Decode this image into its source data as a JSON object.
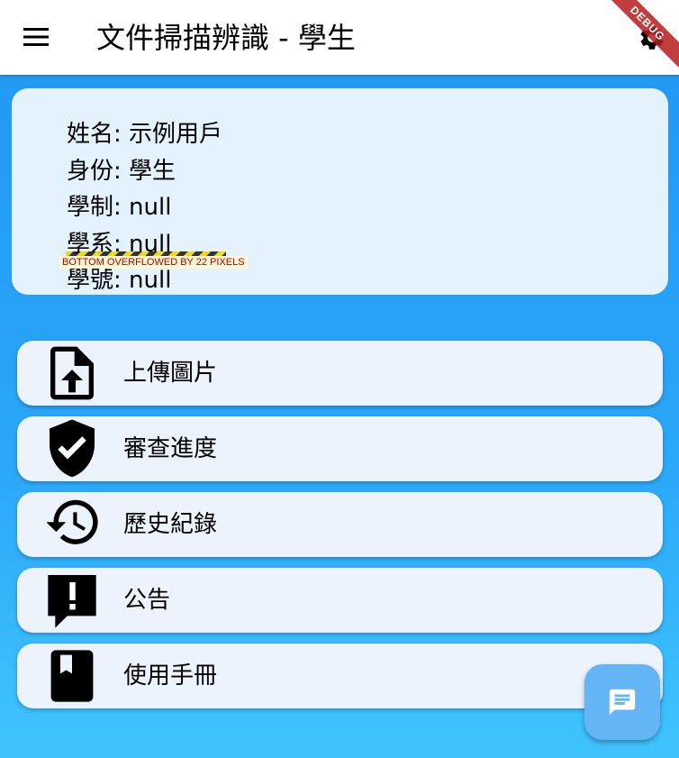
{
  "app_bar": {
    "title": "文件掃描辨識 - 學生",
    "menu_icon": "menu-icon",
    "settings_icon": "gear-icon",
    "background": "#ffffff"
  },
  "debug_banner": "DEBUG",
  "user_info": {
    "lines": [
      "姓名: 示例用戶",
      "身份: 學生",
      "學制: null",
      "學系: null",
      "學號: null"
    ],
    "overflow_warning": "BOTTOM OVERFLOWED BY 22 PIXELS",
    "background": "#E3F2FD"
  },
  "menu": {
    "items": [
      {
        "label": "上傳圖片",
        "icon": "upload-file-icon"
      },
      {
        "label": "審查進度",
        "icon": "verified-shield-icon"
      },
      {
        "label": "歷史紀錄",
        "icon": "history-icon"
      },
      {
        "label": "公告",
        "icon": "announcement-icon"
      },
      {
        "label": "使用手冊",
        "icon": "book-icon"
      }
    ],
    "background": "#ECF3FC"
  },
  "fab": {
    "icon": "chat-icon",
    "background": "#64B5F6"
  },
  "colors": {
    "gradient_top": "#2196F3",
    "gradient_bottom": "#40C4FF"
  }
}
